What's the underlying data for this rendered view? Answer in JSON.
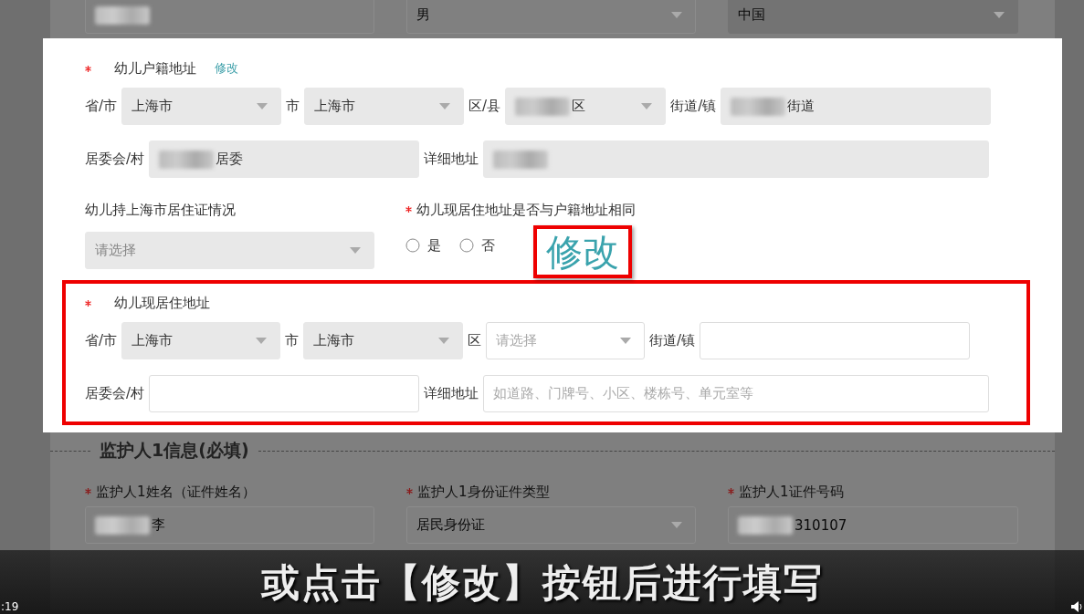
{
  "top_fields": [
    {
      "kind": "text",
      "redacted": true
    },
    {
      "kind": "select",
      "value": "男"
    },
    {
      "kind": "select",
      "value": "中国",
      "disabled": true
    }
  ],
  "household": {
    "title": "幼儿户籍地址",
    "required": true,
    "edit_link": "修改",
    "fields": [
      {
        "label": "省/市",
        "kind": "select",
        "value": "上海市",
        "disabled": true
      },
      {
        "label": "市",
        "kind": "select",
        "value": "上海市",
        "disabled": true
      },
      {
        "label": "区/县",
        "kind": "select",
        "value": "区",
        "redacted": true,
        "disabled": true
      },
      {
        "label": "街道/镇",
        "kind": "text",
        "value": "街道",
        "redacted": true,
        "disabled": true
      },
      {
        "label": "居委会/村",
        "kind": "text",
        "value": "居委",
        "redacted": true,
        "disabled": true
      },
      {
        "label": "详细地址",
        "kind": "text",
        "redacted": true,
        "disabled": true
      }
    ]
  },
  "permit": {
    "label": "幼儿持上海市居住证情况",
    "field": {
      "kind": "select",
      "placeholder": "请选择",
      "disabled": true
    }
  },
  "same_address": {
    "label": "幼儿现居住地址是否与户籍地址相同",
    "required": true,
    "options": [
      {
        "label": "是",
        "selected": false
      },
      {
        "label": "否",
        "selected": false
      }
    ]
  },
  "callout": {
    "text": "修改"
  },
  "current": {
    "title": "幼儿现居住地址",
    "required": true,
    "highlighted": true,
    "fields": [
      {
        "label": "省/市",
        "kind": "select",
        "value": "上海市",
        "disabled": true
      },
      {
        "label": "市",
        "kind": "select",
        "value": "上海市",
        "disabled": true
      },
      {
        "label": "区",
        "kind": "select",
        "placeholder": "请选择",
        "disabled": false
      },
      {
        "label": "街道/镇",
        "kind": "text",
        "disabled": false
      },
      {
        "label": "居委会/村",
        "kind": "text",
        "disabled": false
      },
      {
        "label": "详细地址",
        "kind": "text",
        "placeholder": "如道路、门牌号、小区、楼栋号、单元室等",
        "disabled": false
      }
    ]
  },
  "guardian": {
    "title": "监护人1信息(必填)",
    "fields": [
      {
        "label": "监护人1姓名（证件姓名）",
        "required": true,
        "field": {
          "kind": "text",
          "value": "李",
          "redacted": true
        }
      },
      {
        "label": "监护人1身份证件类型",
        "required": true,
        "field": {
          "kind": "select",
          "value": "居民身份证"
        }
      },
      {
        "label": "监护人1证件号码",
        "required": true,
        "field": {
          "kind": "text",
          "value": "310107",
          "redacted": true
        }
      }
    ]
  },
  "subtitle": "或点击【修改】按钮后进行填写",
  "player": {
    "time": ":19"
  }
}
